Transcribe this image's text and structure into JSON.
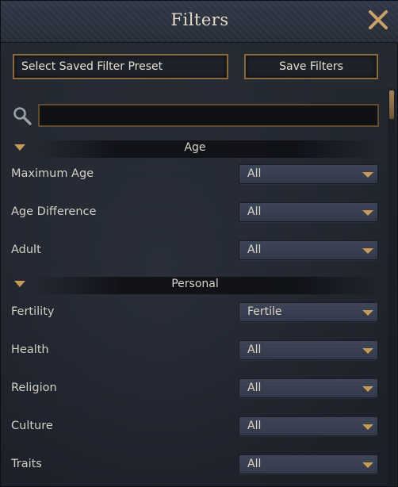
{
  "window": {
    "title": "Filters"
  },
  "toolbar": {
    "preset_label": "Select Saved Filter Preset",
    "save_label": "Save Filters"
  },
  "search": {
    "value": "",
    "placeholder": ""
  },
  "sections": [
    {
      "title": "Age",
      "rows": [
        {
          "label": "Maximum Age",
          "value": "All"
        },
        {
          "label": "Age Difference",
          "value": "All"
        },
        {
          "label": "Adult",
          "value": "All"
        }
      ]
    },
    {
      "title": "Personal",
      "rows": [
        {
          "label": "Fertility",
          "value": "Fertile"
        },
        {
          "label": "Health",
          "value": "All"
        },
        {
          "label": "Religion",
          "value": "All"
        },
        {
          "label": "Culture",
          "value": "All"
        },
        {
          "label": "Traits",
          "value": "All"
        }
      ]
    }
  ],
  "icons": {
    "close": "close-icon",
    "search": "search-icon",
    "collapse": "collapse-arrow-icon",
    "dropdown": "chevron-down-icon"
  },
  "colors": {
    "accent_gold": "#c79a55",
    "button_border": "#8a6a3c",
    "panel_bg": "#20252e",
    "dropdown_bg": "#3a4152"
  }
}
